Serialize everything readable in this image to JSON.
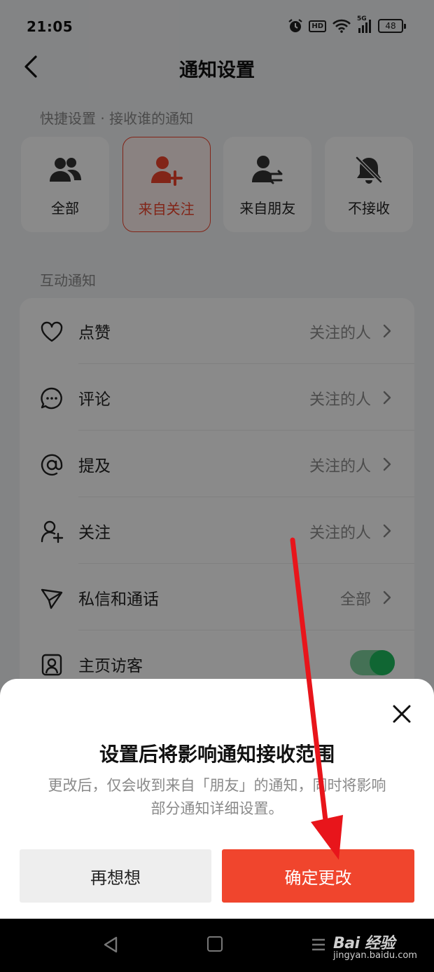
{
  "status_bar": {
    "time": "21:05",
    "hd": "HD",
    "network": "5G",
    "battery": "48"
  },
  "header": {
    "title": "通知设置"
  },
  "quick_settings": {
    "label": "快捷设置 · 接收谁的通知",
    "options": [
      {
        "label": "全部",
        "icon": "users-icon"
      },
      {
        "label": "来自关注",
        "icon": "user-plus-icon",
        "selected": true
      },
      {
        "label": "来自朋友",
        "icon": "user-swap-icon"
      },
      {
        "label": "不接收",
        "icon": "bell-off-icon"
      }
    ]
  },
  "interaction": {
    "label": "互动通知",
    "rows": [
      {
        "label": "点赞",
        "value": "关注的人",
        "icon": "heart-icon"
      },
      {
        "label": "评论",
        "value": "关注的人",
        "icon": "comment-icon"
      },
      {
        "label": "提及",
        "value": "关注的人",
        "icon": "at-icon"
      },
      {
        "label": "关注",
        "value": "关注的人",
        "icon": "user-add-icon"
      },
      {
        "label": "私信和通话",
        "value": "全部",
        "icon": "send-icon"
      },
      {
        "label": "主页访客",
        "icon": "portrait-icon",
        "toggle": true
      }
    ]
  },
  "dialog": {
    "title": "设置后将影响通知接收范围",
    "description_line1": "更改后，仅会收到来自「朋友」的通知，同时将影响",
    "description_line2": "部分通知详细设置。",
    "cancel_label": "再想想",
    "confirm_label": "确定更改"
  },
  "watermark": {
    "logo": "Bai 经验",
    "url": "jingyan.baidu.com"
  },
  "colors": {
    "accent": "#f0452d",
    "toggle_on": "#1ebd5f",
    "annotation_arrow": "#e8151b"
  }
}
